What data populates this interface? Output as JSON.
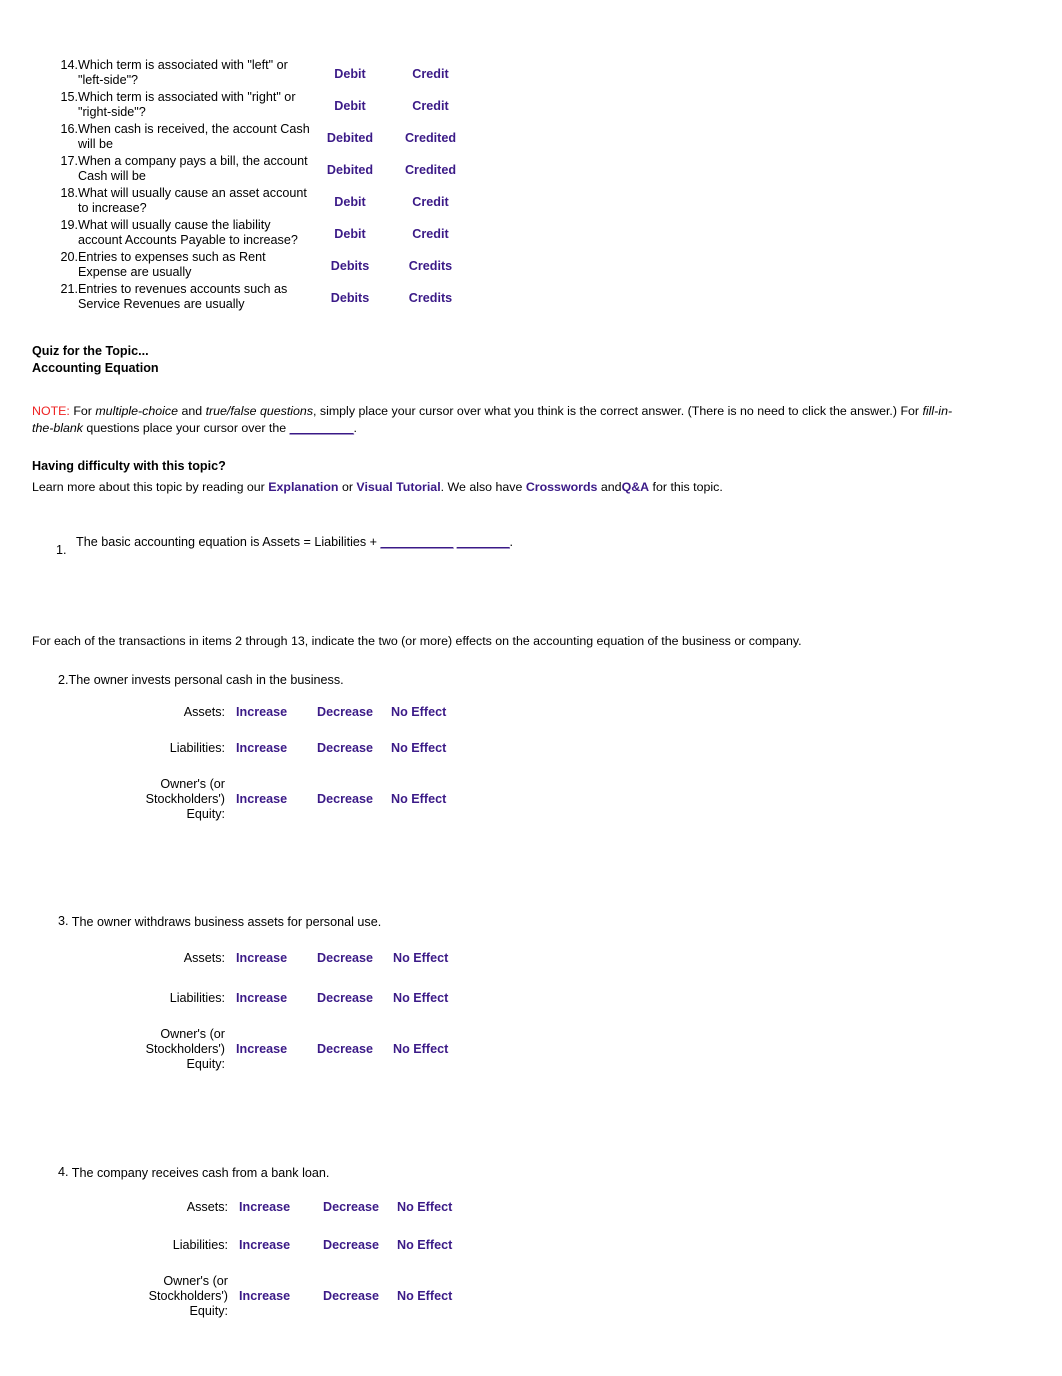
{
  "colors": {
    "answer_purple": "#3b1a87",
    "note_red": "#ee2222",
    "text_black": "#000000",
    "page_background": "#ffffff"
  },
  "debit_credit_table": {
    "rows": [
      {
        "number": "14.",
        "question": "Which term is associated with \"left\" or \"left-side\"?",
        "option_a": "Debit",
        "option_b": "Credit"
      },
      {
        "number": "15.",
        "question": "Which term is associated with \"right\" or \"right-side\"?",
        "option_a": "Debit",
        "option_b": "Credit"
      },
      {
        "number": "16.",
        "question": "When cash is received, the account Cash will be",
        "option_a": "Debited",
        "option_b": "Credited"
      },
      {
        "number": "17.",
        "question": "When a company pays a bill, the account Cash will be",
        "option_a": "Debited",
        "option_b": "Credited"
      },
      {
        "number": "18.",
        "question": "What will usually cause an asset account to increase?",
        "option_a": "Debit",
        "option_b": "Credit"
      },
      {
        "number": "19.",
        "question": "What will usually cause the liability account Accounts Payable to increase?",
        "option_a": "Debit",
        "option_b": "Credit"
      },
      {
        "number": "20.",
        "question": "Entries to expenses such as Rent Expense are usually",
        "option_a": "Debits",
        "option_b": "Credits"
      },
      {
        "number": "21.",
        "question": "Entries to revenues accounts such as Service Revenues are usually",
        "option_a": "Debits",
        "option_b": "Credits"
      }
    ]
  },
  "quiz_header": {
    "line1": "Quiz for the Topic...",
    "line2": "Accounting Equation"
  },
  "note": {
    "label": "NOTE:",
    "seg1": " For ",
    "italic1": "multiple-choice",
    "seg2": " and ",
    "italic2": "true/false questions",
    "seg3": ", simply place your cursor over what you think is the correct answer. (There is no need to click the answer.) For ",
    "italic3": "fill-in-the-blank",
    "seg4": " questions place your cursor over the ",
    "blank": "__________",
    "seg5": "."
  },
  "difficulty": {
    "heading": "Having difficulty with this topic?",
    "lead": "Learn more about this topic by reading our ",
    "link_explanation": "Explanation",
    "mid1": " or ",
    "link_visual_tutorial": "Visual Tutorial",
    "mid2": ". We also have ",
    "link_crosswords": "Crosswords",
    "mid3": " and",
    "link_qa": "Q&A",
    "tail": " for this topic."
  },
  "question1": {
    "number": "1.",
    "text_before": "The basic accounting equation is Assets = Liabilities + ",
    "blank1": "___________",
    "blank2": "________",
    "period": "."
  },
  "instruction": "For each of the transactions in items 2 through 13, indicate the two (or more) effects on the accounting equation of the business or company.",
  "effect_options": {
    "increase": "Increase",
    "decrease": "Decrease",
    "no_effect": "No Effect"
  },
  "effect_labels": {
    "assets": "Assets:",
    "liabilities": "Liabilities:",
    "equity_line1": "Owner's (or Stockholders')",
    "equity_line2": "Equity:"
  },
  "transactions": [
    {
      "number": "2.",
      "stem": "The owner invests personal cash in the business.",
      "rows": [
        {
          "label": "Assets:",
          "options": [
            "Increase",
            "Decrease",
            "No Effect"
          ]
        },
        {
          "label": "Liabilities:",
          "options": [
            "Increase",
            "Decrease",
            "No Effect"
          ]
        },
        {
          "label": "Owner's (or Stockholders') Equity:",
          "options": [
            "Increase",
            "Decrease",
            "No Effect"
          ]
        }
      ]
    },
    {
      "number": "3.",
      "stem": "The owner withdraws business assets for personal use.",
      "rows": [
        {
          "label": "Assets:",
          "options": [
            "Increase",
            "Decrease",
            "No Effect"
          ]
        },
        {
          "label": "Liabilities:",
          "options": [
            "Increase",
            "Decrease",
            "No Effect"
          ]
        },
        {
          "label": "Owner's (or Stockholders') Equity:",
          "options": [
            "Increase",
            "Decrease",
            "No Effect"
          ]
        }
      ]
    },
    {
      "number": "4.",
      "stem": "The company receives cash from a bank loan.",
      "rows": [
        {
          "label": "Assets:",
          "options": [
            "Increase",
            "Decrease",
            "No Effect"
          ]
        },
        {
          "label": "Liabilities:",
          "options": [
            "Increase",
            "Decrease",
            "No Effect"
          ]
        },
        {
          "label": "Owner's (or Stockholders') Equity:",
          "options": [
            "Increase",
            "Decrease",
            "No Effect"
          ]
        }
      ]
    }
  ]
}
